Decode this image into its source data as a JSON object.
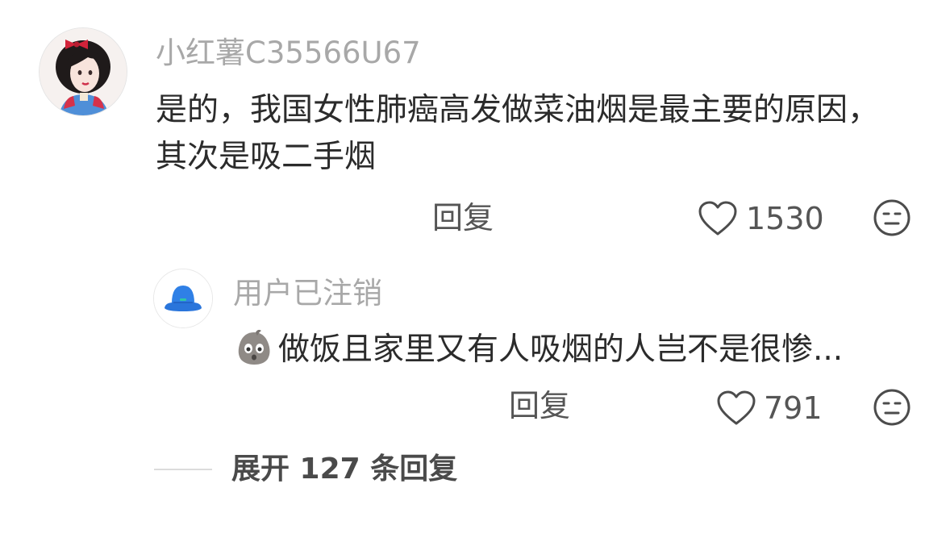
{
  "comment": {
    "username": "小红薯C35566U67",
    "text": "是的，我国女性肺癌高发做菜油烟是最主要的原因，其次是吸二手烟",
    "reply_label": "回复",
    "like_count": "1530",
    "avatar_icon": "snow-white-avatar",
    "like_icon": "heart-outline-icon",
    "reaction_icon": "meh-face-icon"
  },
  "reply": {
    "username": "用户已注销",
    "emoji_icon": "sad-potato-emoji",
    "text": "做饭且家里又有人吸烟的人岂不是很惨...",
    "reply_label": "回复",
    "like_count": "791",
    "avatar_icon": "blue-bucket-hat-avatar",
    "like_icon": "heart-outline-icon",
    "reaction_icon": "meh-face-icon"
  },
  "expand": {
    "label": "展开 127 条回复"
  }
}
